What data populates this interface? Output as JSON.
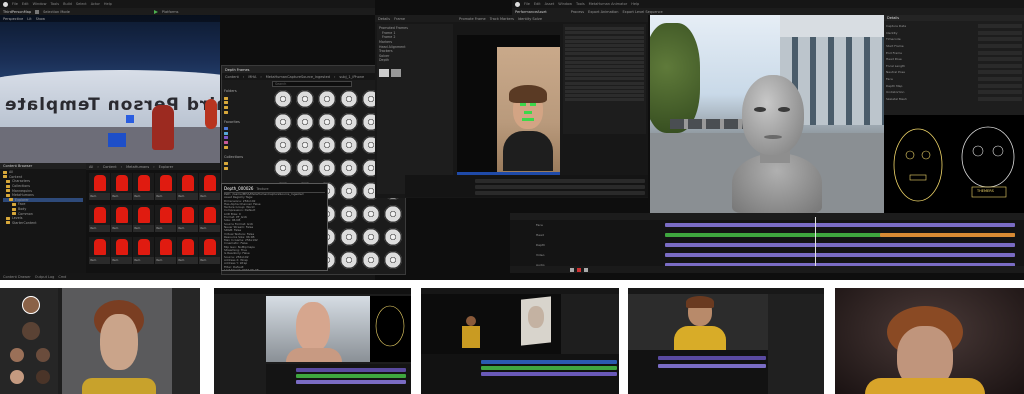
{
  "left_editor": {
    "menu": [
      "File",
      "Edit",
      "Window",
      "Tools",
      "Build",
      "Select",
      "Actor",
      "Help"
    ],
    "map_tab": "ThirdPersonMap",
    "toolbar": {
      "mode": "Selection Mode",
      "platforms": "Platforms"
    },
    "viewport": {
      "mode": "Perspective",
      "lit": "Lit",
      "show": "Show",
      "scene_text": "Third Person Template"
    },
    "content_browser_title": "Content Browser",
    "outliner_title": "Outliner",
    "browser_path": [
      "All",
      "Content",
      "MetaHumans",
      "Explorer"
    ],
    "browser_item_label": "Item",
    "folders": [
      "All",
      "Content",
      "Characters",
      "Collections",
      "Mannequins",
      "MetaHumans",
      "Explorer",
      "Face",
      "Body",
      "Common",
      "Levels",
      "StarterContent"
    ],
    "bottom_tabs": [
      "Content Drawer",
      "Output Log",
      "Cmd"
    ]
  },
  "depth_frames": {
    "title": "Depth Frames",
    "path": [
      "Content",
      "MHA",
      "MetaHumanCaptureSource_Ingested",
      "subj_1_iPhone"
    ],
    "search_placeholder": "Search",
    "sidebar_groups": [
      "Favorites",
      "Depth Frames",
      "Content"
    ],
    "sidebar_items": [
      "Folders",
      "Favorites",
      "Collections",
      "Folder"
    ],
    "status": "360 items (1 selected)"
  },
  "tooltip": {
    "title": "Depth_000026",
    "subtitle": "Texture",
    "lines": [
      "Path: /Game/MHA/MetaHumanCaptureSource_Ingested",
      "Asset Registry Tags:",
      "Dimensions: 256x192",
      "Has Alpha Channel: False",
      "Texture Group: World",
      "Compression: Default",
      "LOD Bias: 0",
      "Format: PF_G16",
      "Size: 96 KB",
      "Source Format: G16",
      "Never Stream: False",
      "SRGB: False",
      "Virtual Texture: False",
      "Resource Size: 96 KB",
      "Max In Game: 256x192",
      "Cinematic: False",
      "Mip Gen: NoMipmaps",
      "Streaming: True",
      "Is Readonly: False",
      "Source: 256x192",
      "Address X: Wrap",
      "Address Y: Wrap",
      "Filter: Default",
      "Last Saved: 2023-06-08"
    ]
  },
  "identity_editor": {
    "tabs": [
      "Details",
      "Frame"
    ],
    "properties": [
      "Promoted Frames",
      "Frame 1",
      "Frame 2",
      "Markers",
      "Head Alignment",
      "Trackers",
      "Solver",
      "Depth"
    ],
    "toolbar": [
      "Promote Frame",
      "Track Markers",
      "Identity Solve"
    ]
  },
  "mh_editor": {
    "menu": [
      "File",
      "Edit",
      "Asset",
      "Window",
      "Tools",
      "MetaHuman Animator",
      "Help"
    ],
    "tab": "PerformanceAsset",
    "toolbar": [
      "Process",
      "Export Animation",
      "Export Level Sequence"
    ],
    "details_title": "Details",
    "sections": [
      "Performance",
      "Source",
      "Visualization",
      "Diagnostics"
    ],
    "property_rows": [
      "Capture Data",
      "Identity",
      "Timecode",
      "Start Frame",
      "End Frame",
      "Head Pose",
      "Focal Length",
      "Neutral Pose",
      "Face",
      "Depth Map",
      "Undistortion",
      "Skeletal Mesh"
    ],
    "rig_label": "THEMERS",
    "timeline_tracks": [
      "Face",
      "Head",
      "Depth",
      "Video",
      "Audio"
    ]
  },
  "thumbnails": [
    {
      "name": "metahuman-creator"
    },
    {
      "name": "identity-solve-preview"
    },
    {
      "name": "animation-sequencer-preview"
    },
    {
      "name": "performance-editor-preview"
    },
    {
      "name": "final-render"
    }
  ],
  "colors": {
    "tracking_green": "#3cd84a",
    "asset_red": "#e01b10",
    "timeline_purple": "#7a6cc4",
    "timeline_green": "#3fa63f",
    "timeline_orange": "#d88a34",
    "folder": "#d8a83a"
  }
}
